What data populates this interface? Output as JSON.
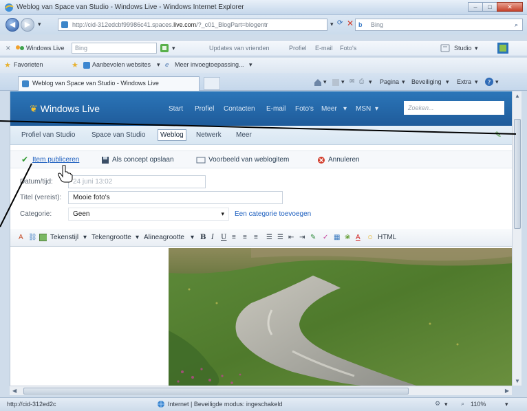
{
  "window": {
    "title": "Weblog van Space van Studio - Windows Live - Windows Internet Explorer",
    "address": "http://cid-312edcbf99986c41.spaces.",
    "address_domain": "live.com",
    "address_rest": "/?_c01_BlogPart=blogentr",
    "search_placeholder": "Bing"
  },
  "live_toolbar": {
    "brand": "Windows Live",
    "search_value": "Bing",
    "links": [
      "Updates van vrienden",
      "Profiel",
      "E-mail",
      "Foto's"
    ],
    "studio": "Studio"
  },
  "favorites_bar": {
    "favorites": "Favorieten",
    "suggested": "Aanbevolen websites",
    "more": "Meer invoegtoepassing..."
  },
  "tab": {
    "label": "Weblog van Space van Studio - Windows Live"
  },
  "command_bar": {
    "page": "Pagina",
    "security": "Beveiliging",
    "extra": "Extra"
  },
  "live_header": {
    "logo": "Windows Live",
    "nav": [
      "Start",
      "Profiel",
      "Contacten",
      "E-mail",
      "Foto's",
      "Meer",
      "MSN"
    ],
    "search_placeholder": "Zoeken..."
  },
  "subnav": {
    "items": [
      "Profiel van Studio",
      "Space van Studio",
      "Weblog",
      "Netwerk",
      "Meer"
    ],
    "selected": "Weblog"
  },
  "actions": {
    "publish": "Item publiceren",
    "save_draft": "Als concept opslaan",
    "preview": "Voorbeeld van weblogitem",
    "cancel": "Annuleren"
  },
  "form": {
    "date_label": "Datum/tijd:",
    "date_value": "24 juni 13:02",
    "title_label": "Titel (vereist):",
    "title_value": "Mooie foto's",
    "category_label": "Categorie:",
    "category_value": "Geen",
    "add_category": "Een categorie toevoegen"
  },
  "editor_toolbar": {
    "font_style": "Tekenstijl",
    "font_size": "Tekengrootte",
    "paragraph_size": "Alineagrootte",
    "bold": "B",
    "italic": "I",
    "underline": "U",
    "html": "HTML"
  },
  "statusbar": {
    "url": "http://cid-312ed2c",
    "zone": "Internet | Beveiligde modus: ingeschakeld",
    "zoom": "110%"
  },
  "colors": {
    "live_blue": "#1f5b9a",
    "link_blue": "#1d5fbf",
    "publish_green": "#2e9a2e",
    "cancel_red": "#d23b2a"
  }
}
